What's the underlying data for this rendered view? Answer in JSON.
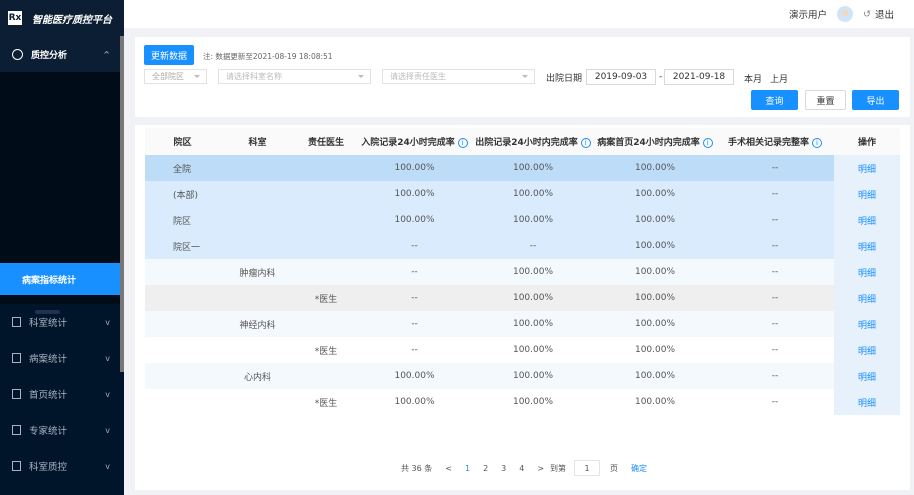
{
  "app": {
    "title": "智能医疗质控平台",
    "logo": "Rx"
  },
  "header": {
    "user": "演示用户",
    "logout": "退出"
  },
  "sidebar": {
    "group": "质控分析",
    "active": "病案指标统计",
    "items": [
      {
        "label": "科室统计"
      },
      {
        "label": "病案统计"
      },
      {
        "label": "首页统计"
      },
      {
        "label": "专家统计"
      },
      {
        "label": "科室质控"
      }
    ]
  },
  "filters": {
    "update_btn": "更新数据",
    "note": "注: 数据更新至2021-08-19 18:08:51",
    "campus": "全部院区",
    "dept_placeholder": "请选择科室名称",
    "doctor_placeholder": "请选择责任医生",
    "date_label": "出院日期",
    "start": "2019-09-03",
    "sep": "-",
    "end": "2021-09-18",
    "this_month": "本月",
    "last_month": "上月",
    "query": "查询",
    "reset": "重置",
    "export": "导出"
  },
  "table": {
    "headers": [
      "院区",
      "科室",
      "责任医生",
      "入院记录24小时完成率",
      "出院记录24小时内完成率",
      "病案首页24小时内完成率",
      "手术相关记录完整率",
      "操作"
    ],
    "rows": [
      [
        "全院",
        "",
        "",
        "100.00%",
        "100.00%",
        "100.00%",
        "--",
        "明细"
      ],
      [
        "(本部)",
        "",
        "",
        "100.00%",
        "100.00%",
        "100.00%",
        "--",
        "明细"
      ],
      [
        "院区",
        "",
        "",
        "100.00%",
        "100.00%",
        "100.00%",
        "--",
        "明细"
      ],
      [
        "院区一",
        "",
        "",
        "--",
        "--",
        "100.00%",
        "--",
        "明细"
      ],
      [
        "",
        "肿瘤内科",
        "",
        "--",
        "100.00%",
        "100.00%",
        "--",
        "明细"
      ],
      [
        "",
        "",
        "*医生",
        "--",
        "100.00%",
        "100.00%",
        "--",
        "明细"
      ],
      [
        "",
        "神经内科",
        "",
        "--",
        "100.00%",
        "100.00%",
        "--",
        "明细"
      ],
      [
        "",
        "",
        "*医生",
        "--",
        "100.00%",
        "100.00%",
        "--",
        "明细"
      ],
      [
        "",
        "心内科",
        "",
        "100.00%",
        "100.00%",
        "100.00%",
        "--",
        "明细"
      ],
      [
        "",
        "",
        "*医生",
        "100.00%",
        "100.00%",
        "100.00%",
        "--",
        "明细"
      ]
    ]
  },
  "pagination": {
    "total": "共 36 条",
    "prev": "<",
    "pages": [
      "1",
      "2",
      "3",
      "4"
    ],
    "next": ">",
    "goto": "到第",
    "page_value": "1",
    "page_unit": "页",
    "confirm": "确定"
  }
}
